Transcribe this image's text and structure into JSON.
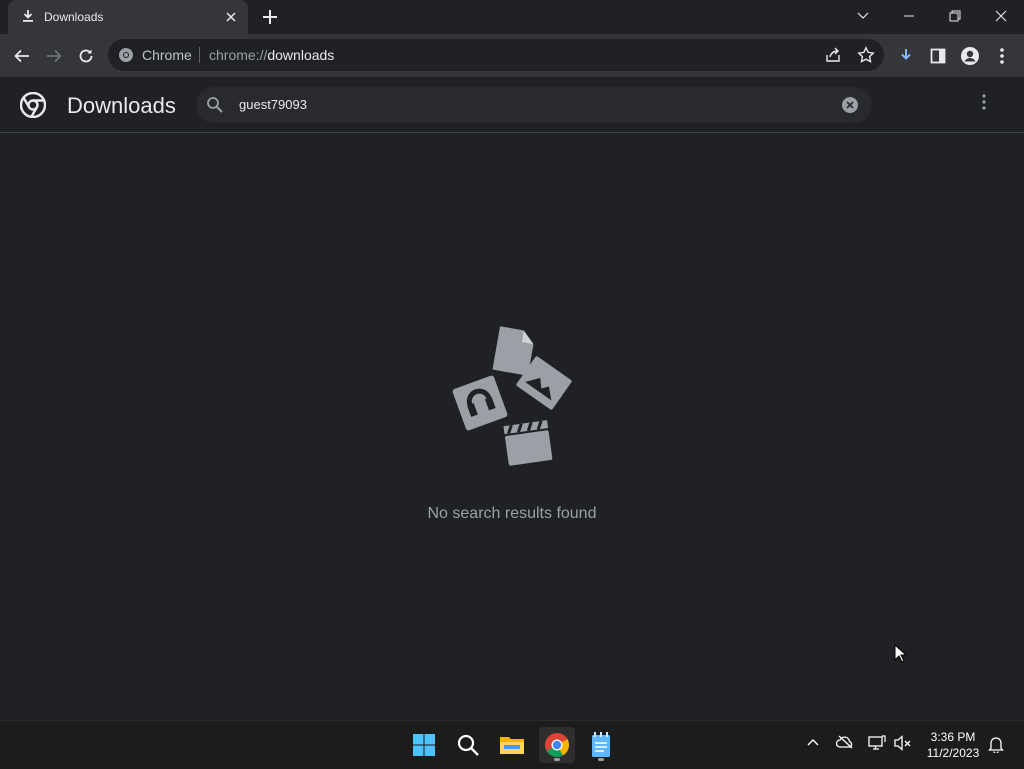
{
  "browser": {
    "tab": {
      "title": "Downloads",
      "icon": "download-icon",
      "close_icon": "close-icon"
    },
    "new_tab_icon": "plus-icon",
    "window_controls": [
      "chevron-down-icon",
      "minimize-icon",
      "restore-icon",
      "close-icon"
    ],
    "toolbar": {
      "nav": [
        "back-icon",
        "forward-icon",
        "reload-icon"
      ],
      "omnibox": {
        "chip_label": "Chrome",
        "url_scheme": "chrome://",
        "url_host": "downloads"
      },
      "right_icons": [
        "share-icon",
        "star-icon",
        "download-icon",
        "side-panel-icon",
        "profile-icon",
        "more-vert-icon"
      ]
    }
  },
  "downloads_page": {
    "title": "Downloads",
    "search": {
      "value": "guest79093"
    },
    "empty_message": "No search results found"
  },
  "taskbar": {
    "apps": [
      "windows-start-icon",
      "search-icon",
      "file-explorer-icon",
      "chrome-icon",
      "notepad-icon"
    ],
    "tray": [
      "chevron-up-icon",
      "onedrive-icon",
      "network-icon",
      "volume-muted-icon"
    ],
    "clock": {
      "time": "3:36 PM",
      "date": "11/2/2023"
    },
    "notification_icon": "bell-icon"
  },
  "colors": {
    "background": "#202124",
    "toolbar": "#35363a",
    "accent_blue": "#8ab4f8",
    "muted_text": "#9aa0a6"
  }
}
